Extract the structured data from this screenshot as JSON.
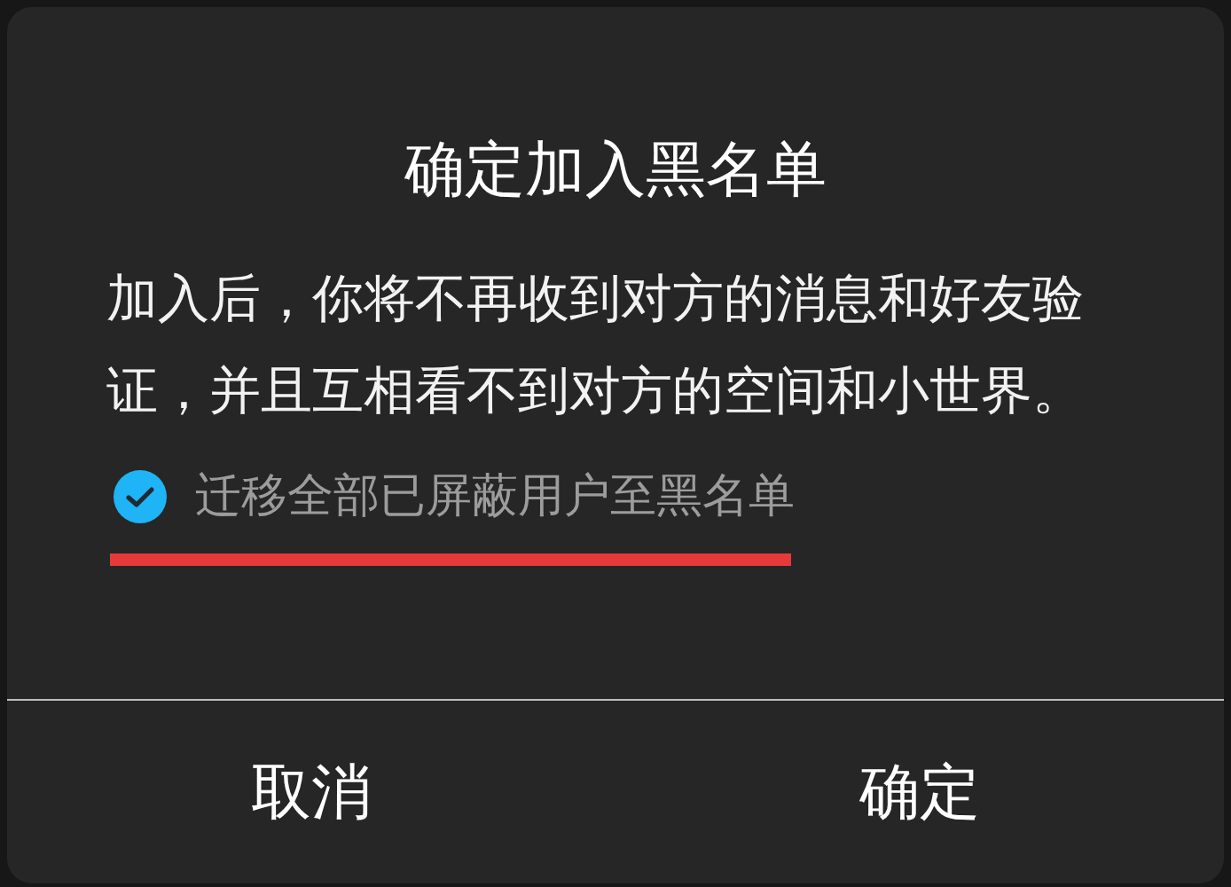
{
  "dialog": {
    "title": "确定加入黑名单",
    "message": "加入后，你将不再收到对方的消息和好友验证，并且互相看不到对方的空间和小世界。",
    "option": {
      "label": "迁移全部已屏蔽用户至黑名单",
      "checked": true
    },
    "buttons": [
      {
        "label": "取消"
      },
      {
        "label": "确定"
      }
    ]
  }
}
